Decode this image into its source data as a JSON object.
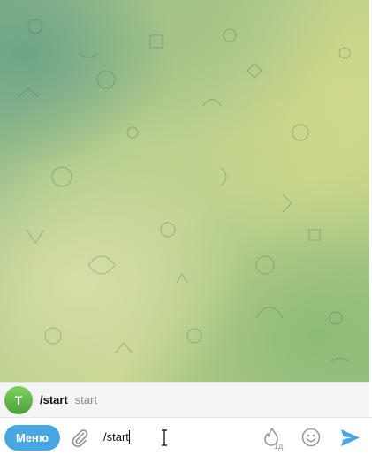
{
  "chat": {
    "background_colors": [
      "#6ea587",
      "#a6c487",
      "#cfd88a",
      "#d6dea8",
      "#8fbb79"
    ]
  },
  "suggestion": {
    "avatar_letter": "T",
    "command": "/start",
    "description": "start"
  },
  "composer": {
    "menu_label": "Меню",
    "input_value": "/start",
    "accent_color": "#4aa6e3",
    "icons": [
      "paperclip-icon",
      "text-cursor-icon",
      "self-destruct-timer-icon",
      "emoji-icon",
      "send-icon"
    ],
    "timer_label": "1д"
  }
}
